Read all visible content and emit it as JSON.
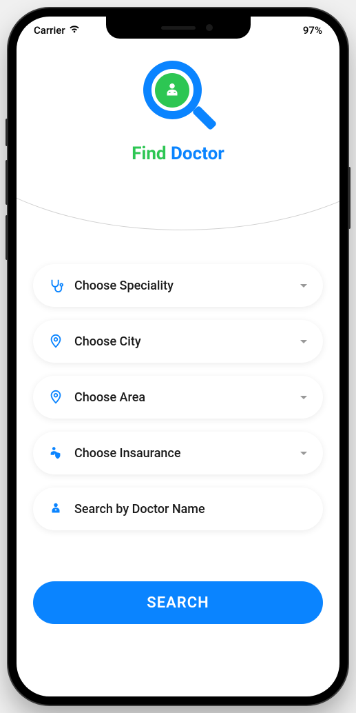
{
  "status": {
    "carrier": "Carrier",
    "battery": "97%"
  },
  "logo": {
    "word1": "Find",
    "word2": "Doctor"
  },
  "dropdowns": {
    "speciality": "Choose Speciality",
    "city": "Choose City",
    "area": "Choose Area",
    "insurance": "Choose Insaurance",
    "doctor_name": "Search by Doctor Name"
  },
  "search_button": "SEARCH"
}
